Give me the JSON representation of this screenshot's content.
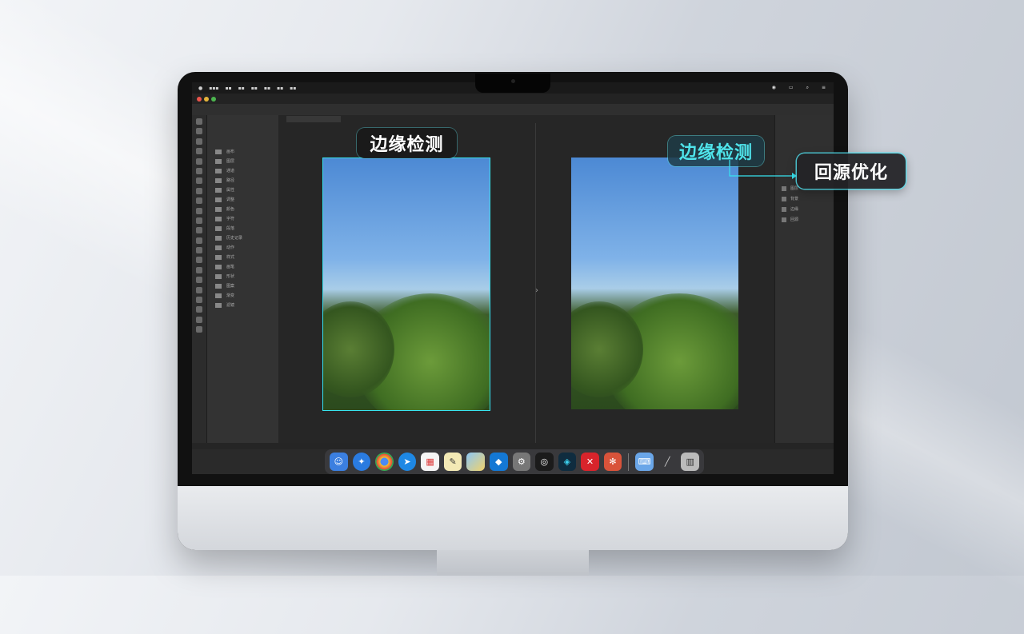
{
  "callouts": {
    "left_label": "边缘检测",
    "right_label": "边缘检测",
    "refine_label": "回源优化"
  },
  "colors": {
    "accent_cyan": "#37e3f0",
    "app_dark": "#2a2a2a"
  },
  "left_panel": {
    "items": [
      "画布",
      "图层",
      "通道",
      "路径",
      "属性",
      "调整",
      "颜色",
      "字符",
      "段落",
      "历史记录",
      "动作",
      "样式",
      "画笔",
      "形状",
      "图案",
      "渐变",
      "滤镜"
    ]
  },
  "right_panel": {
    "items": [
      "图层",
      "背景",
      "边缘",
      "回源"
    ]
  },
  "dock": {
    "apps": [
      "finder-icon",
      "safari-icon",
      "chrome-icon",
      "compass-icon",
      "calendar-icon",
      "notes-icon",
      "preview-icon",
      "store-icon",
      "settings-icon",
      "steam-icon",
      "editor-icon",
      "adobe-icon",
      "media-icon",
      "keyboard-icon",
      "pen-icon",
      "trash-icon"
    ]
  }
}
